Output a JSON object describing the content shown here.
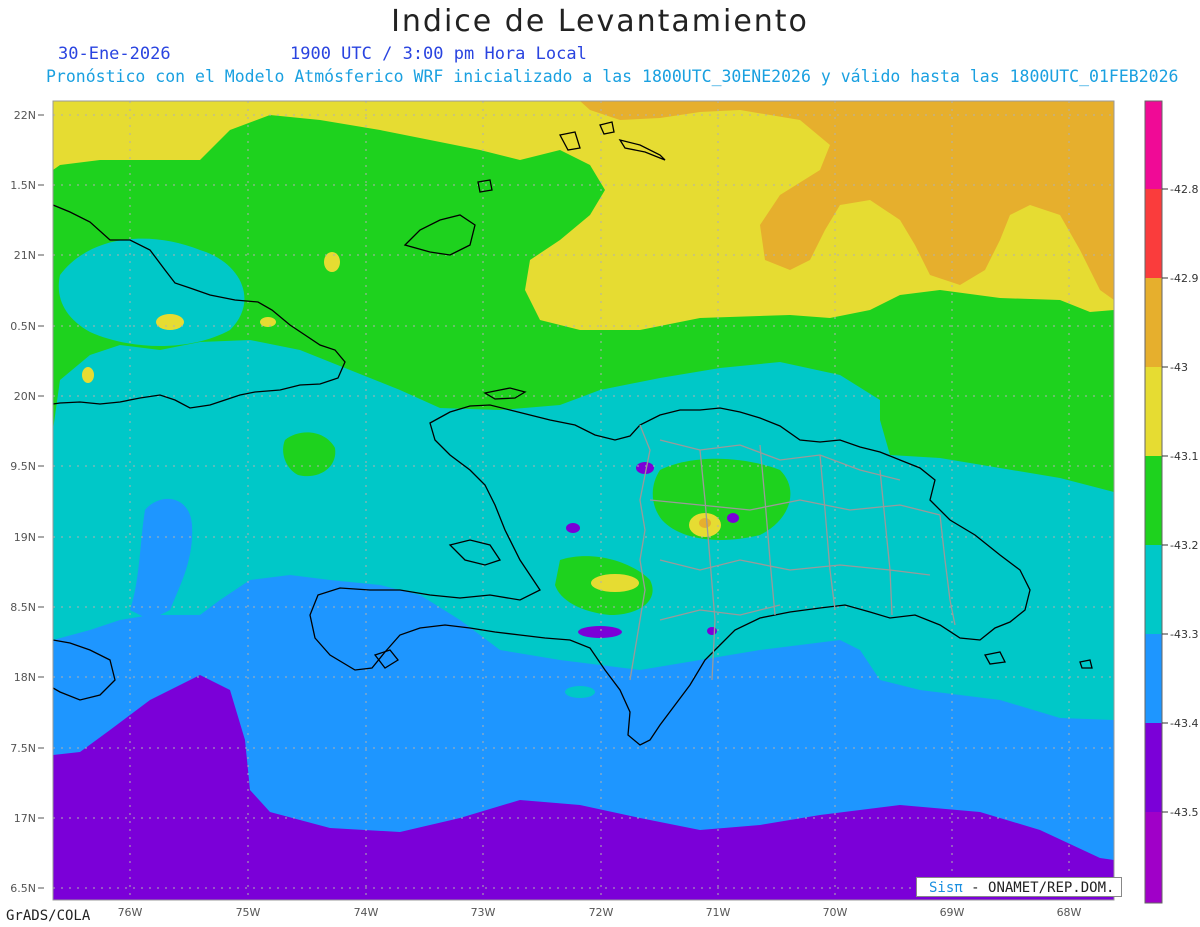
{
  "header": {
    "title": "Indice de Levantamiento",
    "date": "30-Ene-2026",
    "time": "1900 UTC / 3:00 pm Hora Local",
    "subtitle": "Pronóstico con el Modelo Atmósferico WRF inicializado a las 1800UTC_30ENE2026 y válido hasta las  1800UTC_01FEB2026"
  },
  "footer": {
    "credit": "GrADS/COLA",
    "watermark_brand": "Sisπ",
    "watermark_org": "- ONAMET/REP.DOM."
  },
  "map": {
    "lat_labels": [
      "22N",
      "1.5N",
      "21N",
      "0.5N",
      "20N",
      "9.5N",
      "19N",
      "8.5N",
      "18N",
      "7.5N",
      "17N",
      "6.5N"
    ],
    "lon_labels": [
      "76W",
      "75W",
      "74W",
      "73W",
      "72W",
      "71W",
      "70W",
      "69W",
      "68W"
    ],
    "field_colors": {
      "deep_purple": "#7b00d8",
      "blue": "#1e96ff",
      "cyan": "#00c8c8",
      "green": "#1ed21e",
      "yellow": "#e6dc32",
      "orange": "#e6af2d"
    }
  },
  "colorbar": {
    "labels": [
      "-42.8",
      "-42.9",
      "-43",
      "-43.1",
      "-43.2",
      "-43.3",
      "-43.4",
      "-43.5"
    ],
    "colors": [
      "#f00a96",
      "#fa3c3c",
      "#e6af2d",
      "#e6dc32",
      "#1ed21e",
      "#00c8c8",
      "#1e96ff",
      "#7b00d8",
      "#a000c8"
    ]
  }
}
